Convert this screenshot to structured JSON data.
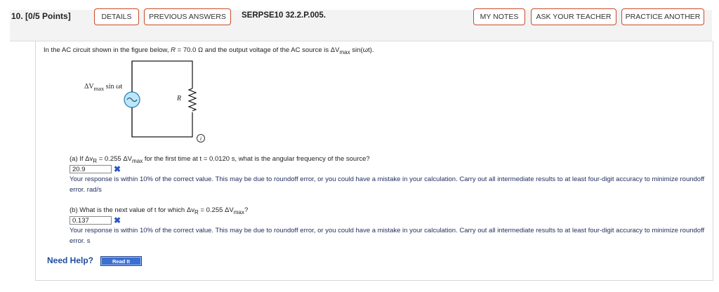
{
  "header": {
    "question_number": "10.",
    "points": "[0/5 Points]",
    "details_label": "DETAILS",
    "previous_answers_label": "PREVIOUS ANSWERS",
    "problem_code": "SERPSE10 32.2.P.005.",
    "my_notes_label": "MY NOTES",
    "ask_teacher_label": "ASK YOUR TEACHER",
    "practice_another_label": "PRACTICE ANOTHER"
  },
  "question": {
    "intro_pre": "In the AC circuit shown in the figure below, ",
    "intro_r": "R",
    "intro_mid": " = 70.0 Ω and the output voltage of the AC source is ΔV",
    "intro_sub": "max",
    "intro_post": " sin(ωt)."
  },
  "figure": {
    "source_label": "ΔV",
    "source_sub": "max",
    "source_post": " sin ωt",
    "resistor_label": "R",
    "info_label": "i"
  },
  "part_a": {
    "prompt_pre": "(a) If Δv",
    "prompt_sub": "R",
    "prompt_mid": " = 0.255 ΔV",
    "prompt_sub2": "max",
    "prompt_post": " for the first time at t = 0.0120 s, what is the angular frequency of the source?",
    "answer": "20.9",
    "mark": "✖",
    "feedback": "Your response is within 10% of the correct value. This may be due to roundoff error, or you could have a mistake in your calculation. Carry out all intermediate results to at least four-digit accuracy to minimize roundoff error. rad/s"
  },
  "part_b": {
    "prompt_pre": "(b) What is the next value of t for which Δv",
    "prompt_sub": "R",
    "prompt_mid": " = 0.255 ΔV",
    "prompt_sub2": "max",
    "prompt_post": "?",
    "answer": "0.137",
    "mark": "✖",
    "feedback": "Your response is within 10% of the correct value. This may be due to roundoff error, or you could have a mistake in your calculation. Carry out all intermediate results to at least four-digit accuracy to minimize roundoff error. s"
  },
  "help": {
    "need_help_label": "Need Help?",
    "read_it_label": "Read It"
  }
}
